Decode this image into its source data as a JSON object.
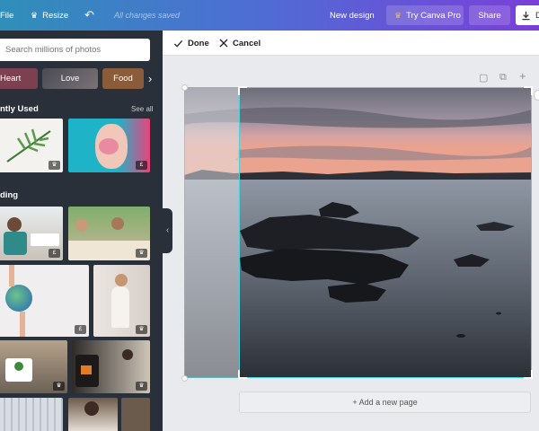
{
  "topbar": {
    "file": "File",
    "resize": "Resize",
    "status": "All changes saved",
    "new_design": "New design",
    "try_pro": "Try Canva Pro",
    "share": "Share",
    "download_letter": "D"
  },
  "sidebar": {
    "search_placeholder": "Search millions of photos",
    "tags": [
      "Heart",
      "Love",
      "Food"
    ],
    "recent_title": "ntly Used",
    "see_all": "See all",
    "trending_title": "ding",
    "badges": {
      "crown": "♛",
      "pound": "£"
    }
  },
  "actionbar": {
    "done": "Done",
    "cancel": "Cancel"
  },
  "canvas": {
    "add_page": "+ Add a new page"
  },
  "colors": {
    "crop_border": "#4ad1dd",
    "sidebar_bg": "#293039"
  }
}
